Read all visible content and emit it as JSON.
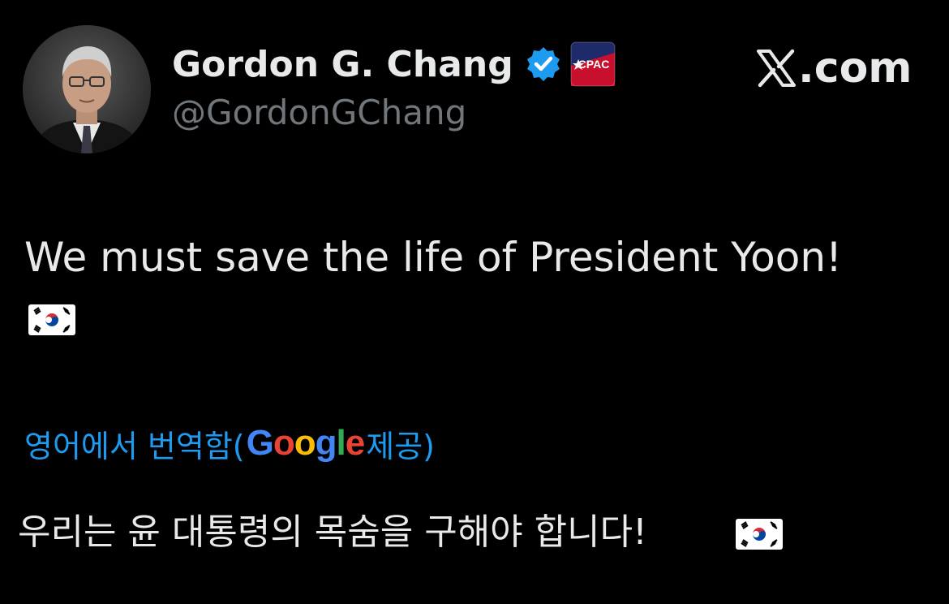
{
  "header": {
    "display_name": "Gordon G. Chang",
    "handle": "@GordonGChang",
    "site_label_suffix": ".com",
    "badge_text": "CPAC"
  },
  "icons": {
    "avatar": "profile-photo",
    "verified": "verified-badge-icon",
    "affiliate": "cpac-affiliate-badge",
    "site": "x-logo-icon",
    "flag": "south-korea-flag"
  },
  "tweet": {
    "text": "We must save the life of President Yoon!"
  },
  "translation": {
    "prefix": "영어에서 번역함(",
    "provider_letters": [
      "G",
      "o",
      "o",
      "g",
      "l",
      "e"
    ],
    "suffix": " 제공)",
    "text": "우리는 윤 대통령의 목숨을 구해야 합니다!"
  },
  "colors": {
    "background": "#000000",
    "primary_text": "#e7e9ea",
    "secondary_text": "#71767b",
    "link": "#1d9bf0",
    "verified": "#1d9bf0",
    "cpac_red": "#c8102e",
    "cpac_blue": "#1f2a6b"
  }
}
